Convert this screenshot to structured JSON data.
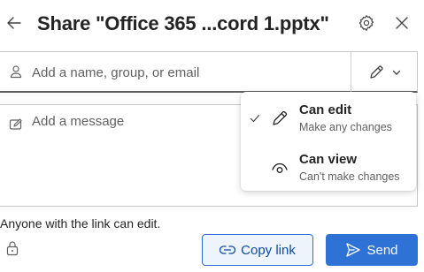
{
  "header": {
    "title": "Share \"Office 365 ...cord 1.pptx\"",
    "back_icon": "arrow-left-icon",
    "settings_icon": "gear-icon",
    "close_icon": "close-icon"
  },
  "recipient": {
    "placeholder": "Add a name, group, or email",
    "value": "",
    "icon": "person-icon",
    "permission_toggle": {
      "icon": "pencil-icon",
      "chevron": "chevron-down-icon"
    }
  },
  "message": {
    "placeholder": "Add a message",
    "value": "",
    "icon": "compose-icon"
  },
  "link_permission_text": "Anyone with the link can edit.",
  "buttons": {
    "copy_link": "Copy link",
    "send": "Send"
  },
  "permission_menu": {
    "items": [
      {
        "label": "Can edit",
        "description": "Make any changes",
        "icon": "pencil-icon",
        "selected": true
      },
      {
        "label": "Can view",
        "description": "Can't make changes",
        "icon": "eye-icon",
        "selected": false
      }
    ]
  },
  "colors": {
    "accent": "#2f72d6",
    "copy_button_bg": "#eef4fc",
    "copy_button_text": "#0f4a9e",
    "text": "#242424",
    "muted_text": "#616161"
  }
}
